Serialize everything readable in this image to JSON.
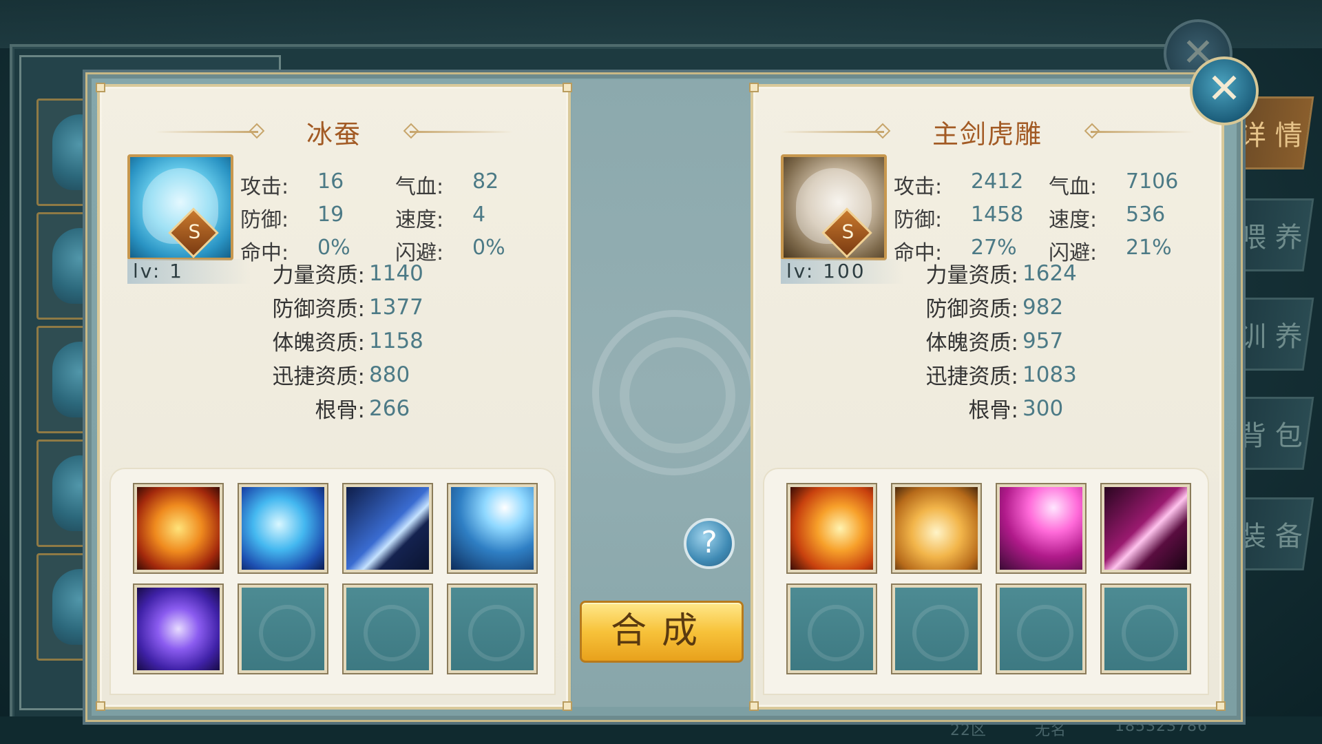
{
  "status_bar": {
    "server": "22区",
    "player_name": "无名",
    "player_id": "185323786"
  },
  "side_tabs": [
    {
      "label": "详 情",
      "active": true
    },
    {
      "label": "喂 养",
      "active": false
    },
    {
      "label": "训 养",
      "active": false
    },
    {
      "label": "背 包",
      "active": false
    },
    {
      "label": "装 备",
      "active": false
    }
  ],
  "left_pet": {
    "name": "冰蚕",
    "rank": "S",
    "level": "lv: 1",
    "stats": [
      {
        "k": "攻击:",
        "v": "16"
      },
      {
        "k": "气血:",
        "v": "82"
      },
      {
        "k": "防御:",
        "v": "19"
      },
      {
        "k": "速度:",
        "v": "4"
      },
      {
        "k": "命中:",
        "v": "0%"
      },
      {
        "k": "闪避:",
        "v": "0%"
      }
    ],
    "aptitudes": [
      {
        "k": "力量资质:",
        "v": "1140"
      },
      {
        "k": "防御资质:",
        "v": "1377"
      },
      {
        "k": "体魄资质:",
        "v": "1158"
      },
      {
        "k": "迅捷资质:",
        "v": "880"
      },
      {
        "k": "根骨:",
        "v": "266"
      }
    ],
    "skills": [
      "fire-orb-skill-icon",
      "frost-beast-skill-icon",
      "claw-slash-skill-icon",
      "lightning-skill-icon",
      "vortex-skill-icon",
      "empty",
      "empty",
      "empty"
    ]
  },
  "right_pet": {
    "name": "主剑虎雕",
    "rank": "S",
    "level": "lv: 100",
    "stats": [
      {
        "k": "攻击:",
        "v": "2412"
      },
      {
        "k": "气血:",
        "v": "7106"
      },
      {
        "k": "防御:",
        "v": "1458"
      },
      {
        "k": "速度:",
        "v": "536"
      },
      {
        "k": "命中:",
        "v": "27%"
      },
      {
        "k": "闪避:",
        "v": "21%"
      }
    ],
    "aptitudes": [
      {
        "k": "力量资质:",
        "v": "1624"
      },
      {
        "k": "防御资质:",
        "v": "982"
      },
      {
        "k": "体魄资质:",
        "v": "957"
      },
      {
        "k": "迅捷资质:",
        "v": "1083"
      },
      {
        "k": "根骨:",
        "v": "300"
      }
    ],
    "skills": [
      "phoenix-skill-icon",
      "golden-tiger-skill-icon",
      "pink-lightning-skill-icon",
      "pink-claw-skill-icon",
      "empty",
      "empty",
      "empty",
      "empty"
    ]
  },
  "help_button": {
    "label": "?"
  },
  "compose_button": {
    "label": "合成"
  },
  "close_button": {
    "label": "✕"
  }
}
